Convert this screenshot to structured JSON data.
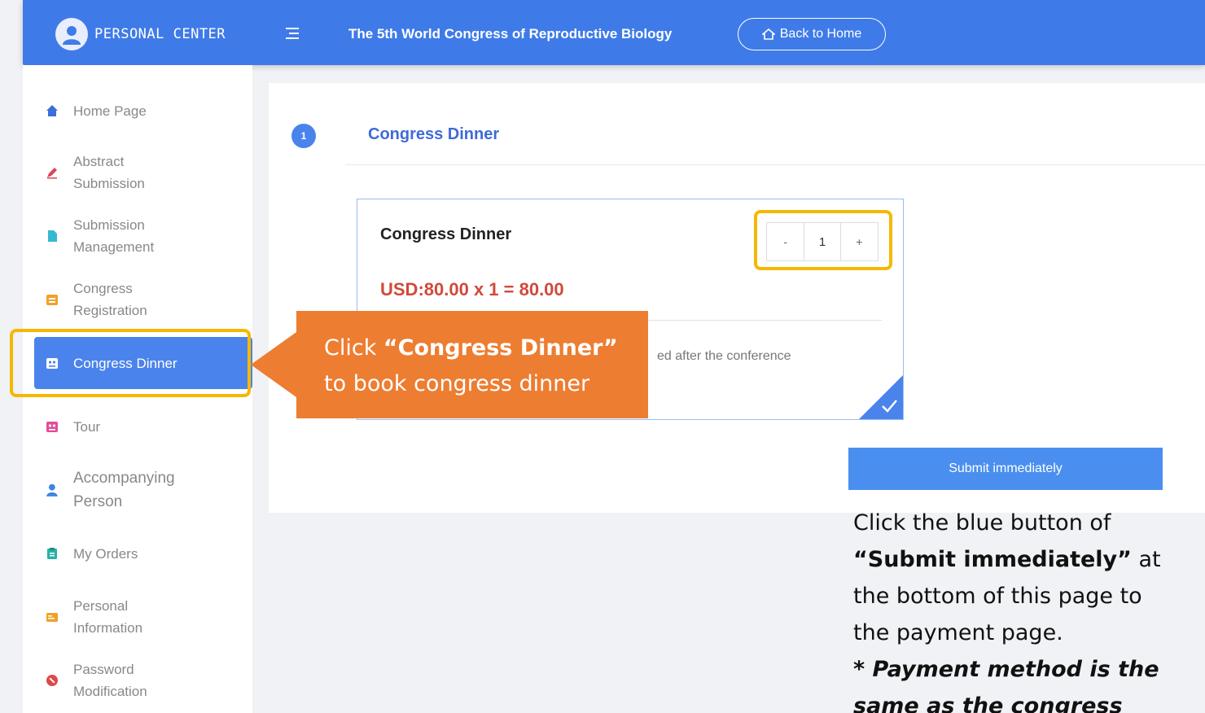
{
  "header": {
    "logo_text": "PERSONAL CENTER",
    "title": "The 5th World Congress of Reproductive Biology",
    "back_home_label": "Back to Home"
  },
  "sidebar": {
    "items": [
      {
        "label": "Home Page",
        "icon": "home-icon",
        "color": "#3b6fd8"
      },
      {
        "label": "Abstract Submission",
        "icon": "edit-icon",
        "color": "#d9465a"
      },
      {
        "label": "Submission Management",
        "icon": "document-icon",
        "color": "#35b8d0"
      },
      {
        "label": "Congress Registration",
        "icon": "registration-icon",
        "color": "#f0a12b"
      },
      {
        "label": "Congress Dinner",
        "icon": "dinner-icon",
        "color": "#ffffff"
      },
      {
        "label": "Tour",
        "icon": "tour-icon",
        "color": "#e34d9a"
      },
      {
        "label": "Accompanying Person",
        "icon": "person-icon",
        "color": "#3b86e0"
      },
      {
        "label": "My Orders",
        "icon": "orders-icon",
        "color": "#27b3a3"
      },
      {
        "label": "Personal Information",
        "icon": "id-card-icon",
        "color": "#f0a12b"
      },
      {
        "label": "Password Modification",
        "icon": "password-icon",
        "color": "#e04848"
      }
    ],
    "active_index": 4
  },
  "main": {
    "step_number": "1",
    "section_title": "Congress Dinner",
    "card": {
      "title": "Congress Dinner",
      "quantity": "1",
      "minus_label": "-",
      "plus_label": "+",
      "price_text": "USD:80.00 x 1 = 80.00",
      "note_partial": "ed after the conference"
    },
    "submit_label": "Submit immediately"
  },
  "annotations": {
    "callout_prefix": "Click ",
    "callout_bold": "“Congress Dinner”",
    "callout_suffix": "to book congress dinner",
    "instr_1": "Click the blue button of",
    "instr_2_bold": "“Submit immediately”",
    "instr_2_rest": " at",
    "instr_3": "the bottom of this page to",
    "instr_4": "the payment page.",
    "instr_5_italic": "* Payment method is the",
    "instr_6_italic": "same as the congress"
  },
  "colors": {
    "header_blue": "#3f7be8",
    "active_blue": "#4a83eb",
    "price_red": "#d04a3a",
    "callout_orange": "#ed7d31",
    "highlight_yellow": "#f5b800"
  }
}
